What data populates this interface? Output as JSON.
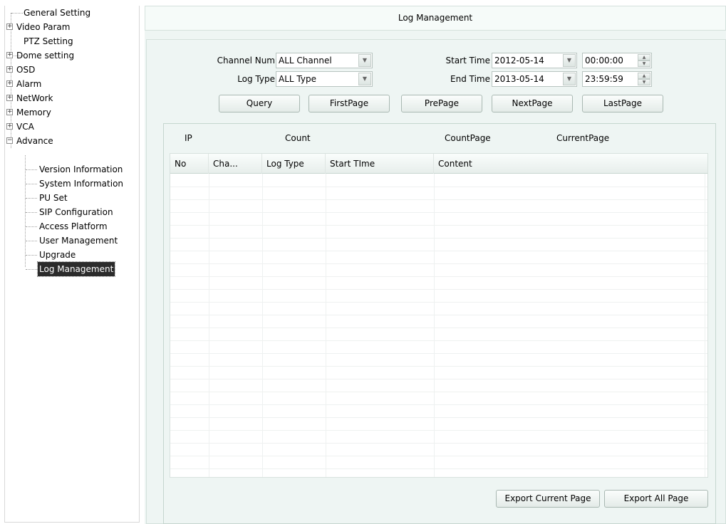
{
  "sidebar": {
    "items": [
      {
        "label": "General Setting",
        "expandable": false
      },
      {
        "label": "Video Param",
        "expandable": true,
        "expander": "+"
      },
      {
        "label": "PTZ Setting",
        "expandable": false
      },
      {
        "label": "Dome setting",
        "expandable": true,
        "expander": "+"
      },
      {
        "label": "OSD",
        "expandable": true,
        "expander": "+"
      },
      {
        "label": "Alarm",
        "expandable": true,
        "expander": "+"
      },
      {
        "label": "NetWork",
        "expandable": true,
        "expander": "+"
      },
      {
        "label": "Memory",
        "expandable": true,
        "expander": "+"
      },
      {
        "label": "VCA",
        "expandable": true,
        "expander": "+"
      },
      {
        "label": "Advance",
        "expandable": true,
        "expander": "−",
        "expanded": true
      }
    ],
    "children": [
      {
        "label": "Version Information"
      },
      {
        "label": "System Information"
      },
      {
        "label": "PU Set"
      },
      {
        "label": "SIP Configuration"
      },
      {
        "label": "Access Platform"
      },
      {
        "label": "User Management"
      },
      {
        "label": "Upgrade"
      },
      {
        "label": "Log Management",
        "selected": true
      }
    ]
  },
  "main": {
    "title": "Log Management",
    "channel_num_label": "Channel Num",
    "channel_num_value": "ALL Channel",
    "log_type_label": "Log Type",
    "log_type_value": "ALL Type",
    "start_time_label": "Start Time",
    "start_date": "2012-05-14",
    "start_clock": "00:00:00",
    "end_time_label": "End Time",
    "end_date": "2013-05-14",
    "end_clock": "23:59:59",
    "buttons": {
      "query": "Query",
      "first_page": "FirstPage",
      "pre_page": "PrePage",
      "next_page": "NextPage",
      "last_page": "LastPage",
      "export_current": "Export Current Page",
      "export_all": "Export All Page"
    },
    "info": {
      "ip": "IP",
      "count": "Count",
      "count_page": "CountPage",
      "current_page": "CurrentPage"
    },
    "table": {
      "columns": [
        "No",
        "Cha...",
        "Log Type",
        "Start TIme",
        "Content"
      ],
      "rows": []
    }
  },
  "colors": {
    "panel_bg": "#eef5f3",
    "selected_bg": "#2b2b2b"
  }
}
